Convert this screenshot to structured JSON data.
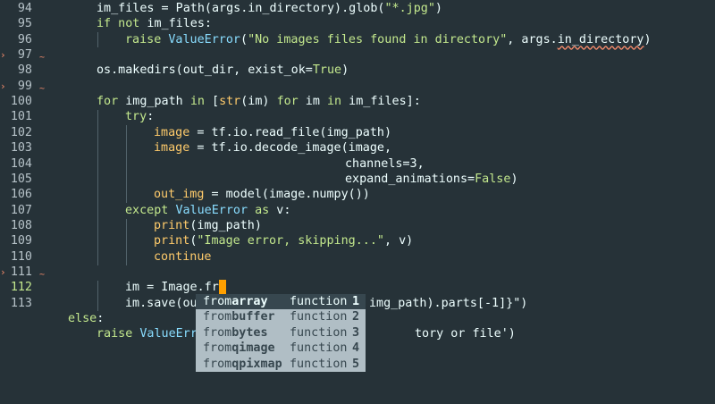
{
  "editor": {
    "lines": [
      {
        "n": "94",
        "segments": [
          [
            "plain",
            "im_files = Path(args.in_directory).glob("
          ],
          [
            "str",
            "\"*.jpg\""
          ],
          [
            "plain",
            ")"
          ]
        ]
      },
      {
        "n": "95",
        "segments": [
          [
            "kw",
            "if not"
          ],
          [
            "plain",
            " im_files:"
          ]
        ]
      },
      {
        "n": "96",
        "segments": [
          [
            "kw",
            "raise"
          ],
          [
            "plain",
            " "
          ],
          [
            "cls",
            "ValueError"
          ],
          [
            "plain",
            "("
          ],
          [
            "str",
            "\"No images files found in directory\""
          ],
          [
            "plain",
            ", args."
          ],
          [
            "squiggle",
            "in_directory"
          ],
          [
            "plain",
            ")"
          ]
        ]
      },
      {
        "n": "97",
        "segments": []
      },
      {
        "n": "98",
        "segments": [
          [
            "plain",
            "os.makedirs(out_dir, exist_ok="
          ],
          [
            "const",
            "True"
          ],
          [
            "plain",
            ")"
          ]
        ]
      },
      {
        "n": "99",
        "segments": []
      },
      {
        "n": "100",
        "segments": [
          [
            "kw",
            "for"
          ],
          [
            "plain",
            " img_path "
          ],
          [
            "kw",
            "in"
          ],
          [
            "plain",
            " ["
          ],
          [
            "bi",
            "str"
          ],
          [
            "plain",
            "(im) "
          ],
          [
            "kw",
            "for"
          ],
          [
            "plain",
            " im "
          ],
          [
            "kw",
            "in"
          ],
          [
            "plain",
            " im_files]:"
          ]
        ]
      },
      {
        "n": "101",
        "segments": [
          [
            "kw",
            "try"
          ],
          [
            "plain",
            ":"
          ]
        ]
      },
      {
        "n": "102",
        "segments": [
          [
            "bi",
            "image"
          ],
          [
            "plain",
            " = tf.io.read_file(img_path)"
          ]
        ]
      },
      {
        "n": "103",
        "segments": [
          [
            "bi",
            "image"
          ],
          [
            "plain",
            " = tf.io.decode_image(image,"
          ]
        ]
      },
      {
        "n": "104",
        "segments": [
          [
            "plain",
            "channels=3,"
          ]
        ]
      },
      {
        "n": "105",
        "segments": [
          [
            "plain",
            "expand_animations="
          ],
          [
            "const",
            "False"
          ],
          [
            "plain",
            ")"
          ]
        ]
      },
      {
        "n": "106",
        "segments": [
          [
            "bi",
            "out_img"
          ],
          [
            "plain",
            " = model(image.numpy())"
          ]
        ]
      },
      {
        "n": "107",
        "segments": [
          [
            "kw",
            "except"
          ],
          [
            "plain",
            " "
          ],
          [
            "cls",
            "ValueError"
          ],
          [
            "plain",
            " "
          ],
          [
            "kw",
            "as"
          ],
          [
            "plain",
            " v:"
          ]
        ]
      },
      {
        "n": "108",
        "segments": [
          [
            "bi",
            "print"
          ],
          [
            "plain",
            "(img_path)"
          ]
        ]
      },
      {
        "n": "109",
        "segments": [
          [
            "bi",
            "print"
          ],
          [
            "plain",
            "("
          ],
          [
            "str",
            "\"Image error, skipping...\""
          ],
          [
            "plain",
            ", v)"
          ]
        ]
      },
      {
        "n": "110",
        "segments": [
          [
            "bi",
            "continue"
          ]
        ]
      },
      {
        "n": "111",
        "segments": []
      },
      {
        "n": "112",
        "segments": [
          [
            "plain",
            "im = Image.fr"
          ]
        ]
      },
      {
        "n": "113",
        "segments": [
          [
            "plain",
            "im.save(ou"
          ]
        ]
      },
      {
        "n": "",
        "segments": [
          [
            "kw",
            "else"
          ],
          [
            "plain",
            ":"
          ]
        ]
      },
      {
        "n": "",
        "segments": [
          [
            "kw",
            "raise"
          ],
          [
            "plain",
            " "
          ],
          [
            "cls",
            "ValueErr"
          ]
        ]
      }
    ],
    "hidden_tails": {
      "line_113": "img_path).parts[-1]}\")",
      "line_raise": "tory or file')"
    }
  },
  "autocomplete": {
    "items": [
      {
        "prefix": "from",
        "match": "array",
        "kind": "function",
        "index": "1"
      },
      {
        "prefix": "from",
        "match": "buffer",
        "kind": "function",
        "index": "2"
      },
      {
        "prefix": "from",
        "match": "bytes",
        "kind": "function",
        "index": "3"
      },
      {
        "prefix": "from",
        "match": "qimage",
        "kind": "function",
        "index": "4"
      },
      {
        "prefix": "from",
        "match": "qpixmap",
        "kind": "function",
        "index": "5"
      }
    ]
  },
  "colors": {
    "background": "#263238",
    "keyword": "#c3e88d",
    "class": "#89ddff",
    "cursor": "#ffa000",
    "popup_bg": "#b0bec5",
    "popup_selected": "#37474f"
  }
}
